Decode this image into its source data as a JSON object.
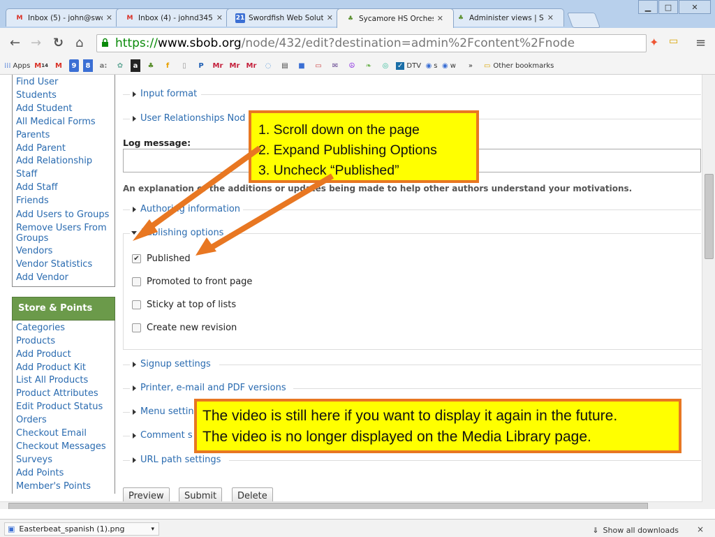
{
  "browser": {
    "tabs": [
      {
        "title": "Inbox (5) - john@swor",
        "favicon": "gmail-icon",
        "active": false
      },
      {
        "title": "Inbox (4) - johnd3452",
        "favicon": "gmail-icon",
        "active": false
      },
      {
        "title": "Swordfish Web Solutio",
        "favicon": "calendar-icon",
        "active": false
      },
      {
        "title": "Sycamore HS Orchestr",
        "favicon": "sbob-icon",
        "active": true
      },
      {
        "title": "Administer views | SBC",
        "favicon": "sbob-icon",
        "active": false
      }
    ],
    "url": {
      "scheme": "https://",
      "host": "www.sbob.org",
      "path": "/node/432/edit?destination=admin%2Fcontent%2Fnode"
    },
    "bookmarks": {
      "apps_label": "Apps",
      "gmail_badge": "14",
      "calendar_badge": "9",
      "dtv_label": "DTV",
      "s_label": "s",
      "w_label": "w",
      "overflow_label": "»",
      "other_label": "Other bookmarks"
    }
  },
  "sidebar": {
    "admin_items": [
      "Find User",
      "Students",
      "Add Student",
      "All Medical Forms",
      "Parents",
      "Add Parent",
      "Add Relationship",
      "Staff",
      "Add Staff",
      "Friends",
      "Add Users to Groups",
      "Remove Users From Groups",
      "Vendors",
      "Vendor Statistics",
      "Add Vendor"
    ],
    "store_title": "Store & Points",
    "store_items": [
      "Categories",
      "Products",
      "Add Product",
      "Add Product Kit",
      "List All Products",
      "Product Attributes",
      "Edit Product Status",
      "Orders",
      "Checkout Email",
      "Checkout Messages",
      "Surveys",
      "Add Points",
      "Member's Points"
    ]
  },
  "main": {
    "input_format": "Input format",
    "user_relationships": "User Relationships Nod",
    "log_message_label": "Log message:",
    "log_message_desc": "An explanation of the additions or updates being made to help other authors understand your motivations.",
    "authoring": "Authoring information",
    "publishing": "Publishing options",
    "checkboxes": [
      {
        "label": "Published",
        "checked": true
      },
      {
        "label": "Promoted to front page",
        "checked": false
      },
      {
        "label": "Sticky at top of lists",
        "checked": false
      },
      {
        "label": "Create new revision",
        "checked": false
      }
    ],
    "signup": "Signup settings",
    "printer": "Printer, e-mail and PDF versions",
    "menu": "Menu settin",
    "comment": "Comment s",
    "url_path": "URL path settings",
    "buttons": {
      "preview": "Preview",
      "submit": "Submit",
      "delete": "Delete"
    }
  },
  "downloads": {
    "file": "Easterbeat_spanish (1).png",
    "show_all": "Show all downloads",
    "close": "×"
  },
  "callouts": {
    "steps": [
      "1. Scroll down on the page",
      "2. Expand Publishing Options",
      "3. Uncheck “Published”"
    ],
    "note": [
      "The video is still here if you want to display it again in the future.",
      "The video is no longer displayed on the Media Library page."
    ]
  },
  "colors": {
    "callout_fill": "#ffff00",
    "callout_border": "#e87722",
    "link": "#2a6bb0",
    "block_header": "#6b9a4a"
  }
}
